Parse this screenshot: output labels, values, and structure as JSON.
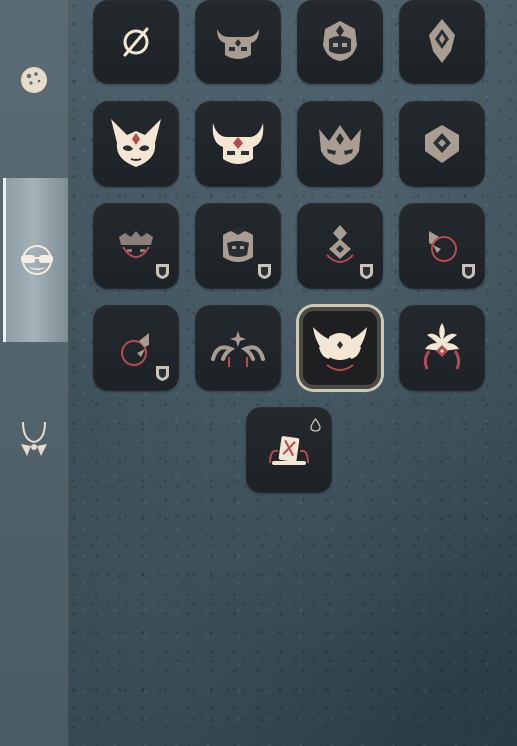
{
  "sidebar": {
    "tabs": [
      {
        "icon": "face-paint-icon",
        "selected": false
      },
      {
        "icon": "glasses-mustache-icon",
        "selected": true
      },
      {
        "icon": "necklace-icon",
        "selected": false
      }
    ]
  },
  "colors": {
    "cream": "#f3e6d2",
    "cream_dim": "#a89d90",
    "locked": "#8b7e76",
    "accent_red": "#b64a52",
    "selected_border": "#cfc6b4"
  },
  "grid": {
    "items": [
      {
        "icon": "none-icon",
        "state": "available"
      },
      {
        "icon": "horned-mask-icon",
        "state": "dim"
      },
      {
        "icon": "crowned-mask-icon",
        "state": "dim"
      },
      {
        "icon": "diamond-headpiece-icon",
        "state": "dim"
      },
      {
        "icon": "winged-horned-mask-icon",
        "state": "unlocked"
      },
      {
        "icon": "bull-horned-mask-icon",
        "state": "unlocked"
      },
      {
        "icon": "spiked-crown-mask-icon",
        "state": "dim"
      },
      {
        "icon": "hooded-diamond-mask-icon",
        "state": "dim"
      },
      {
        "icon": "tiara-red-mask-icon",
        "state": "locked"
      },
      {
        "icon": "helmet-mask-icon",
        "state": "locked"
      },
      {
        "icon": "diamond-crest-mask-icon",
        "state": "locked"
      },
      {
        "icon": "half-mask-left-icon",
        "state": "locked"
      },
      {
        "icon": "half-mask-right-icon",
        "state": "locked"
      },
      {
        "icon": "star-curl-headband-icon",
        "state": "dim"
      },
      {
        "icon": "feathered-wing-mask-icon",
        "state": "selected"
      },
      {
        "icon": "feather-plume-headdress-icon",
        "state": "unlocked"
      },
      {
        "icon": "card-emblem-icon",
        "state": "special"
      }
    ]
  }
}
